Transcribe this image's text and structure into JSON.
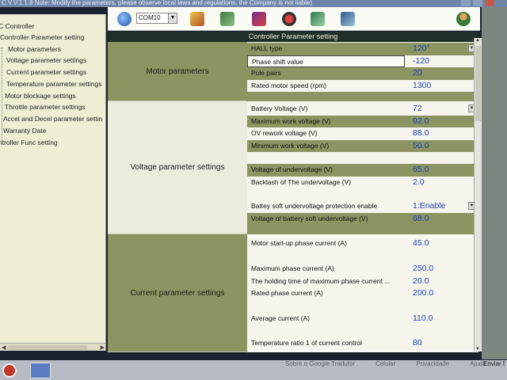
{
  "window": {
    "title": "C.V.V.1.1.8 Note: Modify the parameters, please observe local laws and regulations, the Company is not liable)"
  },
  "sidebar": {
    "items": [
      {
        "label": "C Controller"
      },
      {
        "label": "Controller Parameter setting"
      },
      {
        "label": "Motor parameters"
      },
      {
        "label": "Voltage parameter settings"
      },
      {
        "label": "Current parameter settings"
      },
      {
        "label": "Temperature parameter settings"
      },
      {
        "label": "Motor blockage settings"
      },
      {
        "label": "Throttle parameter settings"
      },
      {
        "label": "Accel and Decel parameter settin"
      },
      {
        "label": "Warranty Date"
      },
      {
        "label": "ntroller Func setting"
      }
    ]
  },
  "toolbar": {
    "com_port": "COM10",
    "icons": [
      "globe-icon",
      "connect-icon",
      "transfer-icon",
      "save-icon",
      "record-icon",
      "flag-icon",
      "export-icon",
      "user-icon"
    ]
  },
  "table": {
    "header": "Controller Parameter setting",
    "groups": [
      {
        "name": "Motor parameters",
        "rows": [
          {
            "name": "HALL type",
            "value": "120°",
            "dropdown": true
          },
          {
            "name": "Phase shift value",
            "value": "-120"
          },
          {
            "name": "Pole pairs",
            "value": "20"
          },
          {
            "name": "Rated motor speed (rpm)",
            "value": "1300"
          }
        ]
      },
      {
        "name": "Voltage parameter settings",
        "rows": [
          {
            "name": "Battery Voltage (V)",
            "value": "72",
            "dropdown": true
          },
          {
            "name": "Maximum work voltage (V)",
            "value": "92.0"
          },
          {
            "name": "OV rework voltage (V)",
            "value": "88.0"
          },
          {
            "name": "Minimum work voltage (V)",
            "value": "50.0"
          },
          {
            "name": "Voltage of undervoltage (V)",
            "value": "65.0"
          },
          {
            "name": "Backlash of The undervoltage (V)",
            "value": "2.0"
          },
          {
            "name": "Battey soft undervoltage protection enable",
            "value": "1:Enable",
            "dropdown": true
          },
          {
            "name": "Voltage of battery soft undervoltage (V)",
            "value": "68.0"
          }
        ]
      },
      {
        "name": "Current parameter settings",
        "rows": [
          {
            "name": "Motor start-up phase current (A)",
            "value": "45.0"
          },
          {
            "name": "Maximum phase current (A)",
            "value": "250.0"
          },
          {
            "name": "The holding time of maximum phase current ...",
            "value": "20.0"
          },
          {
            "name": "Rated phase current (A)",
            "value": "200.0"
          },
          {
            "name": "Average current (A)",
            "value": "110.0"
          },
          {
            "name": "Temperature ratio 1 of current control",
            "value": "80"
          }
        ]
      }
    ]
  },
  "browser_bar": {
    "links": [
      "Sobre o Google Tradutor",
      "Celular",
      "Privacidade",
      "Ajuda"
    ],
    "send": "Enviar f"
  }
}
